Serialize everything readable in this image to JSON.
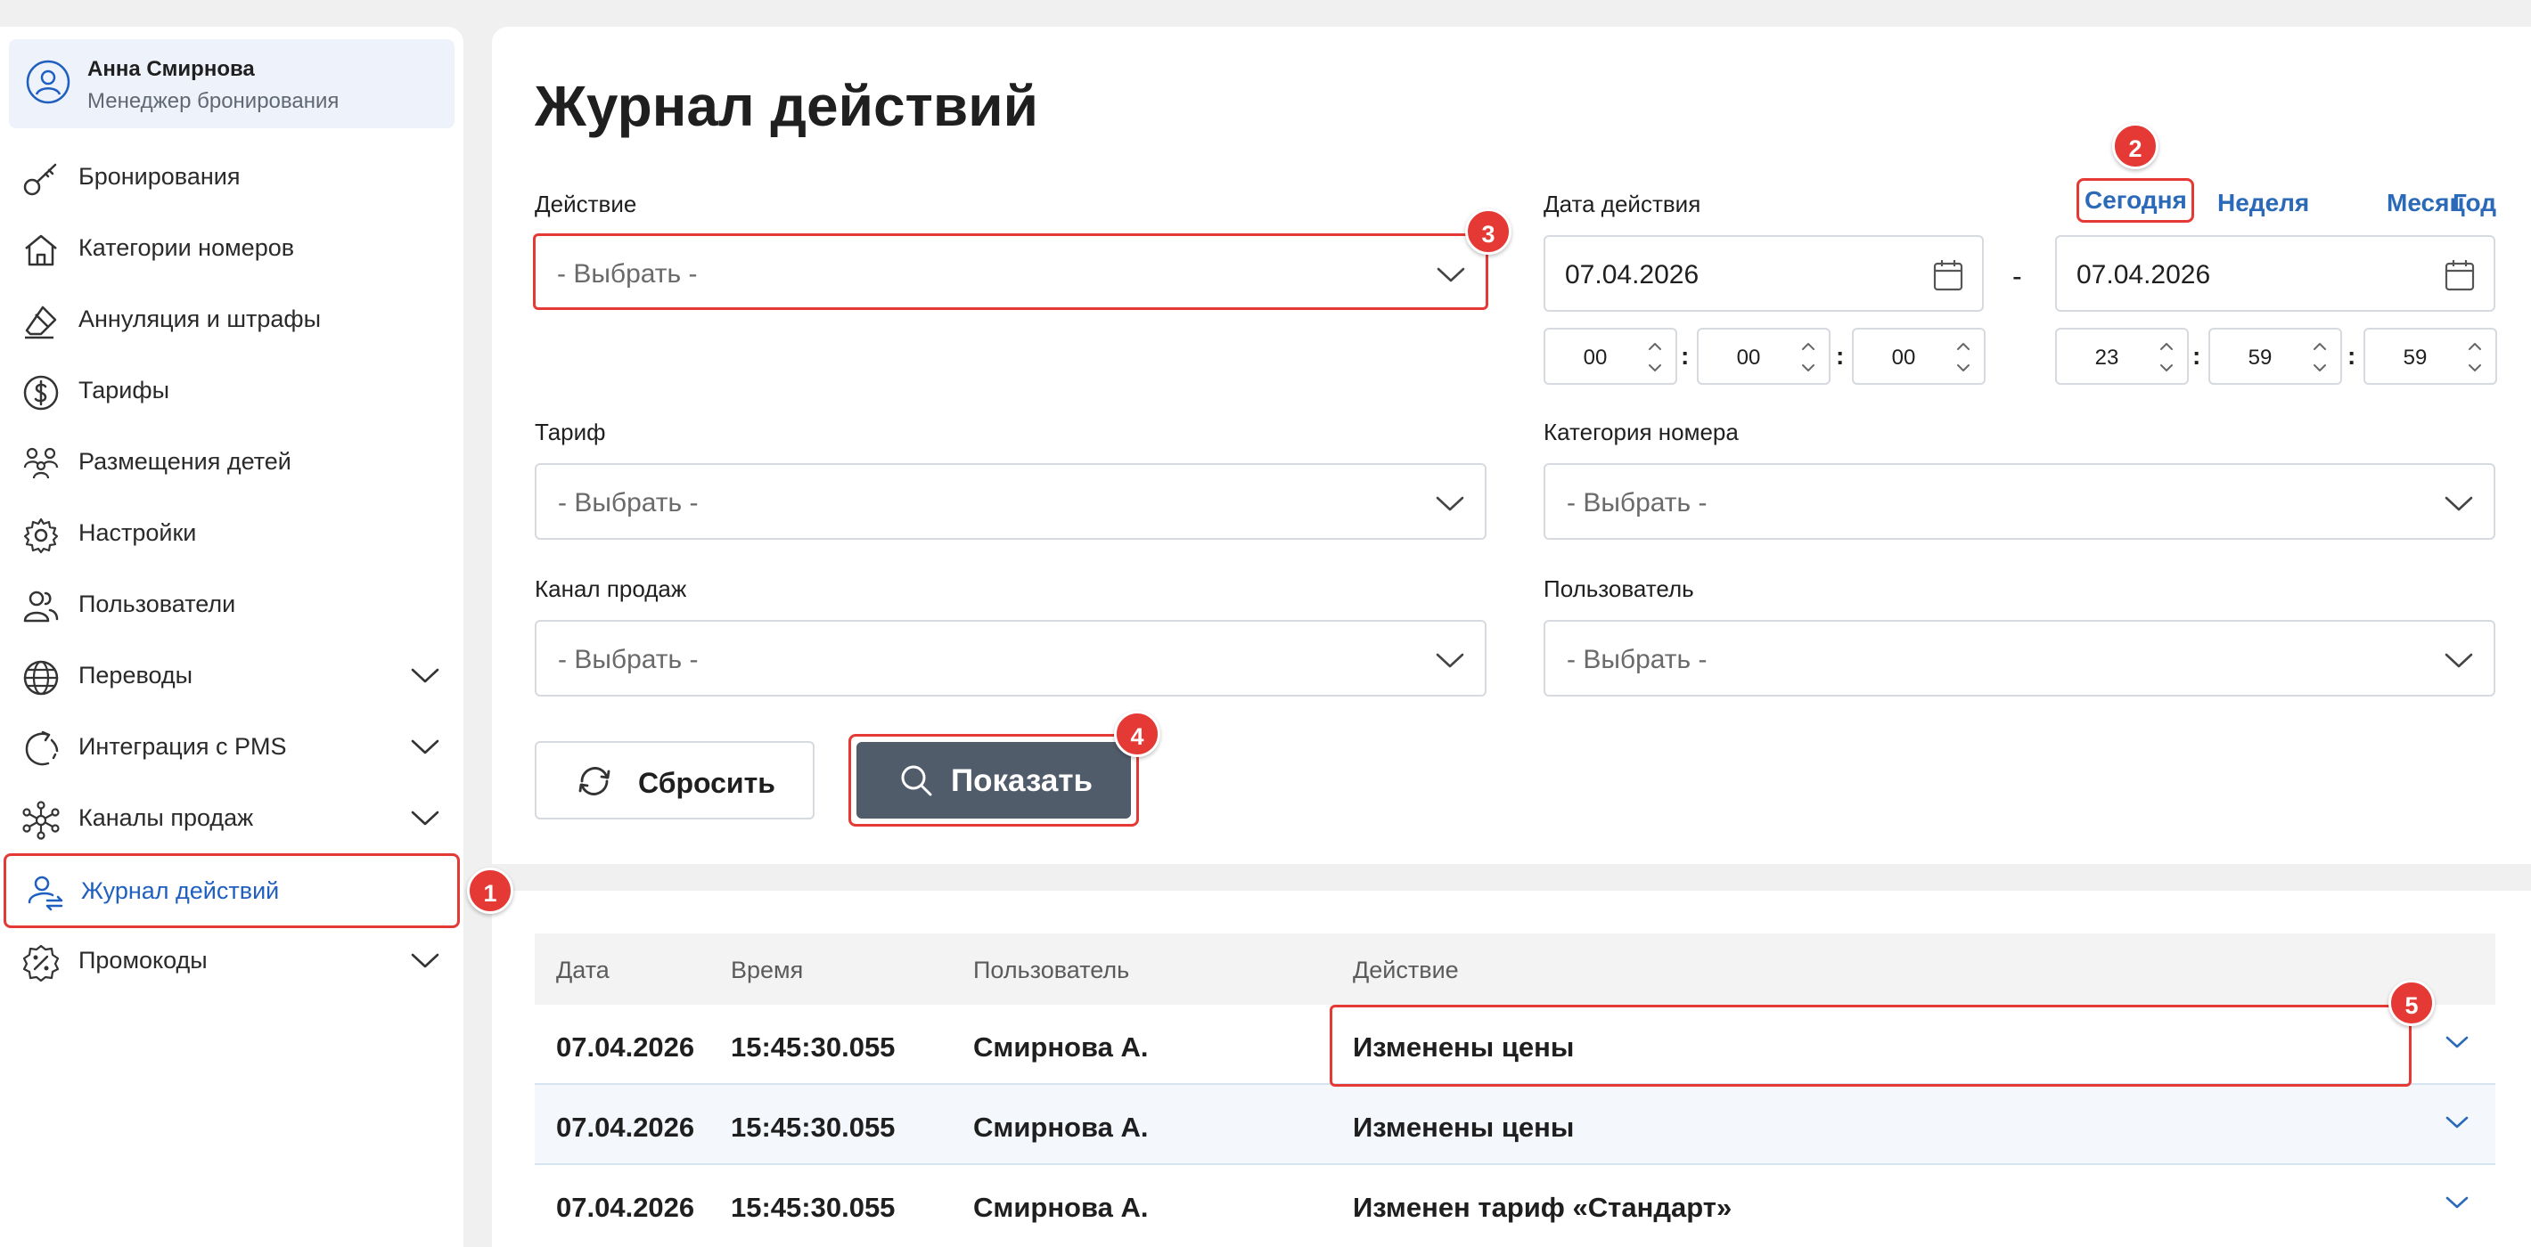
{
  "user": {
    "name": "Анна Смирнова",
    "role": "Менеджер бронирования"
  },
  "sidebar": {
    "items": [
      {
        "label": "Бронирования",
        "icon": "key-icon"
      },
      {
        "label": "Категории номеров",
        "icon": "home-icon"
      },
      {
        "label": "Аннуляция и штрафы",
        "icon": "eraser-icon"
      },
      {
        "label": "Тарифы",
        "icon": "dollar-icon"
      },
      {
        "label": "Размещения детей",
        "icon": "family-icon"
      },
      {
        "label": "Настройки",
        "icon": "gear-icon"
      },
      {
        "label": "Пользователи",
        "icon": "users-icon"
      },
      {
        "label": "Переводы",
        "icon": "globe-icon"
      },
      {
        "label": "Интеграция с PMS",
        "icon": "sync-icon"
      },
      {
        "label": "Каналы продаж",
        "icon": "network-icon"
      },
      {
        "label": "Журнал действий",
        "icon": "user-swap-icon",
        "active": true
      },
      {
        "label": "Промокоды",
        "icon": "percent-badge-icon"
      }
    ]
  },
  "page": {
    "title": "Журнал действий"
  },
  "filters": {
    "action_label": "Действие",
    "action_value": "- Выбрать -",
    "date_label": "Дата действия",
    "quick_today": "Сегодня",
    "quick_week": "Неделя",
    "quick_month": "Месяц",
    "quick_year": "Год",
    "date_from": "07.04.2026",
    "date_to": "07.04.2026",
    "date_separator": "-",
    "time_from": {
      "h": "00",
      "m": "00",
      "s": "00"
    },
    "time_to": {
      "h": "23",
      "m": "59",
      "s": "59"
    },
    "time_sep": ":",
    "tariff_label": "Тариф",
    "tariff_value": "- Выбрать -",
    "room_category_label": "Категория номера",
    "room_category_value": "- Выбрать -",
    "channel_label": "Канал продаж",
    "channel_value": "- Выбрать -",
    "user_label": "Пользователь",
    "user_value": "- Выбрать -",
    "reset_label": "Сбросить",
    "show_label": "Показать"
  },
  "table": {
    "headers": [
      "Дата",
      "Время",
      "Пользователь",
      "Действие"
    ],
    "rows": [
      {
        "date": "07.04.2026",
        "time": "15:45:30.055",
        "user": "Смирнова А.",
        "action": "Изменены цены"
      },
      {
        "date": "07.04.2026",
        "time": "15:45:30.055",
        "user": "Смирнова А.",
        "action": "Изменены цены"
      },
      {
        "date": "07.04.2026",
        "time": "15:45:30.055",
        "user": "Смирнова А.",
        "action": "Изменен тариф «Стандарт»"
      }
    ]
  },
  "callouts": [
    "1",
    "2",
    "3",
    "4",
    "5"
  ],
  "colors": {
    "accent": "#1f5fbf",
    "link": "#2a6ab8",
    "callout": "#e53935",
    "primary_button": "#515c6b"
  }
}
